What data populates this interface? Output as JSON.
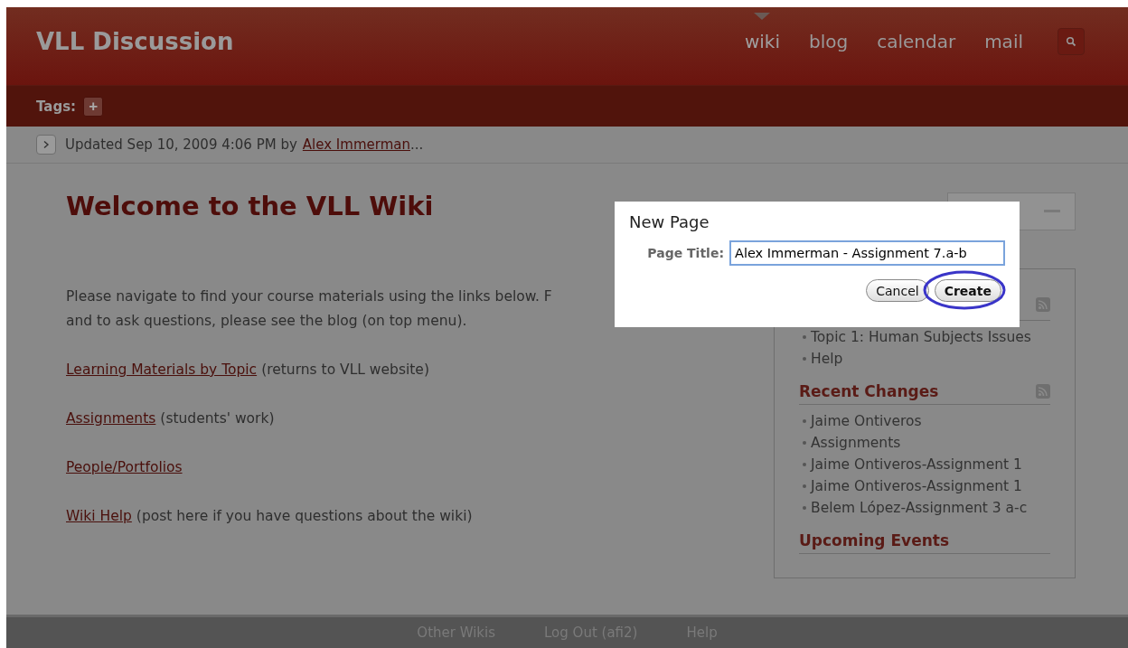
{
  "header": {
    "title": "VLL Discussion",
    "nav": [
      {
        "label": "wiki",
        "selected": true
      },
      {
        "label": "blog",
        "selected": false
      },
      {
        "label": "calendar",
        "selected": false
      },
      {
        "label": "mail",
        "selected": false
      }
    ]
  },
  "tags_bar": {
    "label": "Tags:",
    "add_button": "+"
  },
  "updated": {
    "text": "Updated Sep 10, 2009 4:06 PM by",
    "author": "Alex Immerman",
    "suffix": "..."
  },
  "content": {
    "heading": "Welcome to the VLL Wiki",
    "paragraphs": [
      {
        "kind": "text",
        "lines": [
          "Please navigate to find your course materials using the links below. F",
          "and to ask questions, please see the blog (on top menu)."
        ]
      },
      {
        "kind": "link",
        "link": "Learning Materials by Topic",
        "rest": "(returns to VLL website)"
      },
      {
        "kind": "link",
        "link": "Assignments",
        "rest": "(students' work)"
      },
      {
        "kind": "link",
        "link": "People/Portfolios"
      },
      {
        "kind": "link",
        "link": "Wiki Help",
        "rest": "(post here if you have questions about the wiki)"
      }
    ]
  },
  "sidebar": {
    "sections": [
      {
        "rss": true,
        "items": [
          "Topic 1: Human Subjects Issues",
          "Help"
        ]
      },
      {
        "heading": "Recent Changes",
        "rss": true,
        "items": [
          "Jaime Ontiveros",
          "Assignments",
          "Jaime Ontiveros-Assignment 1",
          "Jaime Ontiveros-Assignment 1",
          "Belem López-Assignment 3 a-c"
        ]
      },
      {
        "heading": "Upcoming Events",
        "rss": false
      }
    ]
  },
  "dialog": {
    "title": "New Page",
    "field_label": "Page Title:",
    "value": "Alex Immerman - Assignment 7.a-b",
    "buttons": [
      {
        "label": "Cancel",
        "kind": "normal",
        "highlighted": false
      },
      {
        "label": "Create",
        "kind": "default",
        "highlighted": true
      }
    ]
  },
  "footer": {
    "links": [
      "Other Wikis",
      "Log Out (afi2)",
      "Help"
    ]
  }
}
